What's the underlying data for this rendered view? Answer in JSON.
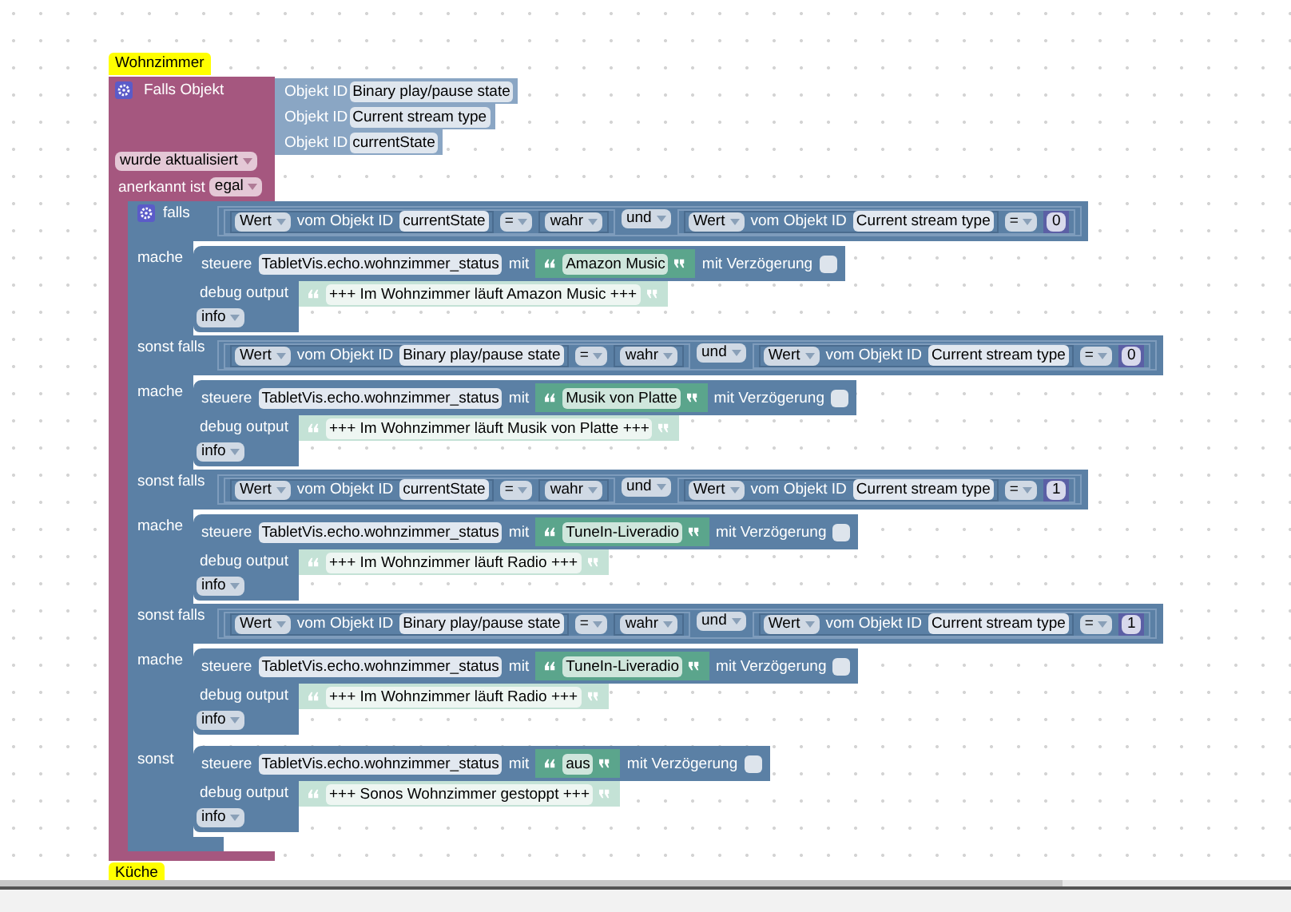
{
  "workspace_label": "Wohnzimmer",
  "trigger": {
    "title": "Falls Objekt",
    "objects": [
      {
        "prefix": "Objekt ID",
        "name": "Binary play/pause state"
      },
      {
        "prefix": "Objekt ID",
        "name": "Current stream type"
      },
      {
        "prefix": "Objekt ID",
        "name": "currentState"
      }
    ],
    "mode": "wurde aktualisiert",
    "ack_label": "anerkannt ist",
    "ack": "egal"
  },
  "if_block": {
    "branches": [
      {
        "keyword": "falls",
        "condition": {
          "left": {
            "field": "Wert",
            "of": "vom Objekt ID",
            "object": "currentState",
            "op": "=",
            "value": {
              "kind": "boolean",
              "text": "wahr"
            }
          },
          "join": "und",
          "right": {
            "field": "Wert",
            "of": "vom Objekt ID",
            "object": "Current stream type",
            "op": "=",
            "value": {
              "kind": "number",
              "text": "0"
            }
          }
        },
        "do_label": "mache",
        "actions": [
          {
            "kind": "control",
            "verb": "steuere",
            "target": "TabletVis.echo.wohnzimmer_status",
            "with_label": "mit",
            "value": "Amazon Music",
            "delay_label": "mit Verzögerung",
            "delay": false
          },
          {
            "kind": "debug",
            "label": "debug output",
            "text": "+++ Im Wohnzimmer läuft Amazon Music +++",
            "level": "info"
          }
        ]
      },
      {
        "keyword": "sonst falls",
        "condition": {
          "left": {
            "field": "Wert",
            "of": "vom Objekt ID",
            "object": "Binary play/pause state",
            "op": "=",
            "value": {
              "kind": "boolean",
              "text": "wahr"
            }
          },
          "join": "und",
          "right": {
            "field": "Wert",
            "of": "vom Objekt ID",
            "object": "Current stream type",
            "op": "=",
            "value": {
              "kind": "number",
              "text": "0"
            }
          }
        },
        "do_label": "mache",
        "actions": [
          {
            "kind": "control",
            "verb": "steuere",
            "target": "TabletVis.echo.wohnzimmer_status",
            "with_label": "mit",
            "value": "Musik von Platte",
            "delay_label": "mit Verzögerung",
            "delay": false
          },
          {
            "kind": "debug",
            "label": "debug output",
            "text": "+++ Im Wohnzimmer läuft Musik von Platte +++",
            "level": "info"
          }
        ]
      },
      {
        "keyword": "sonst falls",
        "condition": {
          "left": {
            "field": "Wert",
            "of": "vom Objekt ID",
            "object": "currentState",
            "op": "=",
            "value": {
              "kind": "boolean",
              "text": "wahr"
            }
          },
          "join": "und",
          "right": {
            "field": "Wert",
            "of": "vom Objekt ID",
            "object": "Current stream type",
            "op": "=",
            "value": {
              "kind": "number",
              "text": "1"
            }
          }
        },
        "do_label": "mache",
        "actions": [
          {
            "kind": "control",
            "verb": "steuere",
            "target": "TabletVis.echo.wohnzimmer_status",
            "with_label": "mit",
            "value": "TuneIn-Liveradio",
            "delay_label": "mit Verzögerung",
            "delay": false
          },
          {
            "kind": "debug",
            "label": "debug output",
            "text": "+++ Im Wohnzimmer läuft Radio +++",
            "level": "info"
          }
        ]
      },
      {
        "keyword": "sonst falls",
        "condition": {
          "left": {
            "field": "Wert",
            "of": "vom Objekt ID",
            "object": "Binary play/pause state",
            "op": "=",
            "value": {
              "kind": "boolean",
              "text": "wahr"
            }
          },
          "join": "und",
          "right": {
            "field": "Wert",
            "of": "vom Objekt ID",
            "object": "Current stream type",
            "op": "=",
            "value": {
              "kind": "number",
              "text": "1"
            }
          }
        },
        "do_label": "mache",
        "actions": [
          {
            "kind": "control",
            "verb": "steuere",
            "target": "TabletVis.echo.wohnzimmer_status",
            "with_label": "mit",
            "value": "TuneIn-Liveradio",
            "delay_label": "mit Verzögerung",
            "delay": false
          },
          {
            "kind": "debug",
            "label": "debug output",
            "text": "+++ Im Wohnzimmer läuft Radio +++",
            "level": "info"
          }
        ]
      }
    ],
    "else": {
      "keyword": "sonst",
      "actions": [
        {
          "kind": "control",
          "verb": "steuere",
          "target": "TabletVis.echo.wohnzimmer_status",
          "with_label": "mit",
          "value": "aus",
          "delay_label": "mit Verzögerung",
          "delay": false
        },
        {
          "kind": "debug",
          "label": "debug output",
          "text": "+++ Sonos Wohnzimmer gestoppt +++",
          "level": "info"
        }
      ]
    }
  },
  "next_label": "Küche"
}
